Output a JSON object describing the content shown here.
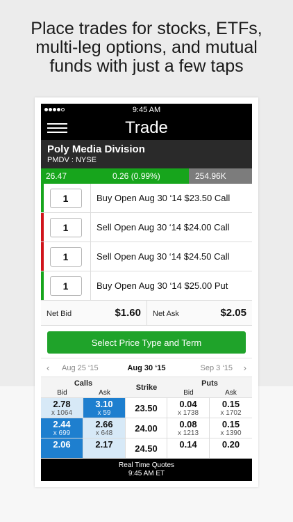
{
  "headline": {
    "line1": "Place trades for stocks, ETFs,",
    "line2": "multi-leg options, and mutual",
    "line3": "funds with just a few taps"
  },
  "status_bar": {
    "time": "9:45 AM",
    "signal_bars_filled": 4,
    "signal_bars_total": 5
  },
  "nav": {
    "title": "Trade",
    "menu_icon": "hamburger-icon"
  },
  "security": {
    "name": "Poly Media Division",
    "symbol_exchange": "PMDV : NYSE"
  },
  "quote": {
    "last": "26.47",
    "change": "0.26 (0.99%)",
    "volume": "254.96K"
  },
  "colors": {
    "buy": "#17a51c",
    "sell": "#d0141b",
    "selected": "#1e7fcf",
    "in_the_money": "#d7e9f7",
    "action": "#1fa32a"
  },
  "legs": [
    {
      "qty": "1",
      "side": "buy",
      "desc": "Buy Open Aug 30 ‘14 $23.50 Call"
    },
    {
      "qty": "1",
      "side": "sell",
      "desc": "Sell Open Aug 30 ‘14 $24.00 Call"
    },
    {
      "qty": "1",
      "side": "sell",
      "desc": "Sell Open Aug 30 ‘14 $24.50 Call"
    },
    {
      "qty": "1",
      "side": "buy",
      "desc": "Buy Open Aug 30 ‘14 $25.00 Put"
    }
  ],
  "net": {
    "bid_label": "Net Bid",
    "bid_value": "$1.60",
    "ask_label": "Net Ask",
    "ask_value": "$2.05"
  },
  "action": {
    "label": "Select Price Type and Term"
  },
  "expiry": {
    "prev": "Aug 25 ‘15",
    "current": "Aug 30 ‘15",
    "next": "Sep 3 ‘15"
  },
  "chain": {
    "headers": {
      "calls": "Calls",
      "puts": "Puts",
      "strike": "Strike",
      "bid": "Bid",
      "ask": "Ask"
    },
    "rows": [
      {
        "call_bid": "2.78",
        "call_bid_size": "x 1064",
        "call_ask": "3.10",
        "call_ask_size": "x 59",
        "strike": "23.50",
        "put_bid": "0.04",
        "put_bid_size": "x 1738",
        "put_ask": "0.15",
        "put_ask_size": "x 1702"
      },
      {
        "call_bid": "2.44",
        "call_bid_size": "x 699",
        "call_ask": "2.66",
        "call_ask_size": "x 648",
        "strike": "24.00",
        "put_bid": "0.08",
        "put_bid_size": "x 1213",
        "put_ask": "0.15",
        "put_ask_size": "x 1390"
      },
      {
        "call_bid": "2.06",
        "call_bid_size": "",
        "call_ask": "2.17",
        "call_ask_size": "",
        "strike": "24.50",
        "put_bid": "0.14",
        "put_bid_size": "",
        "put_ask": "0.20",
        "put_ask_size": ""
      }
    ]
  },
  "footer": {
    "line1": "Real Time Quotes",
    "line2": "9:45 AM ET"
  }
}
